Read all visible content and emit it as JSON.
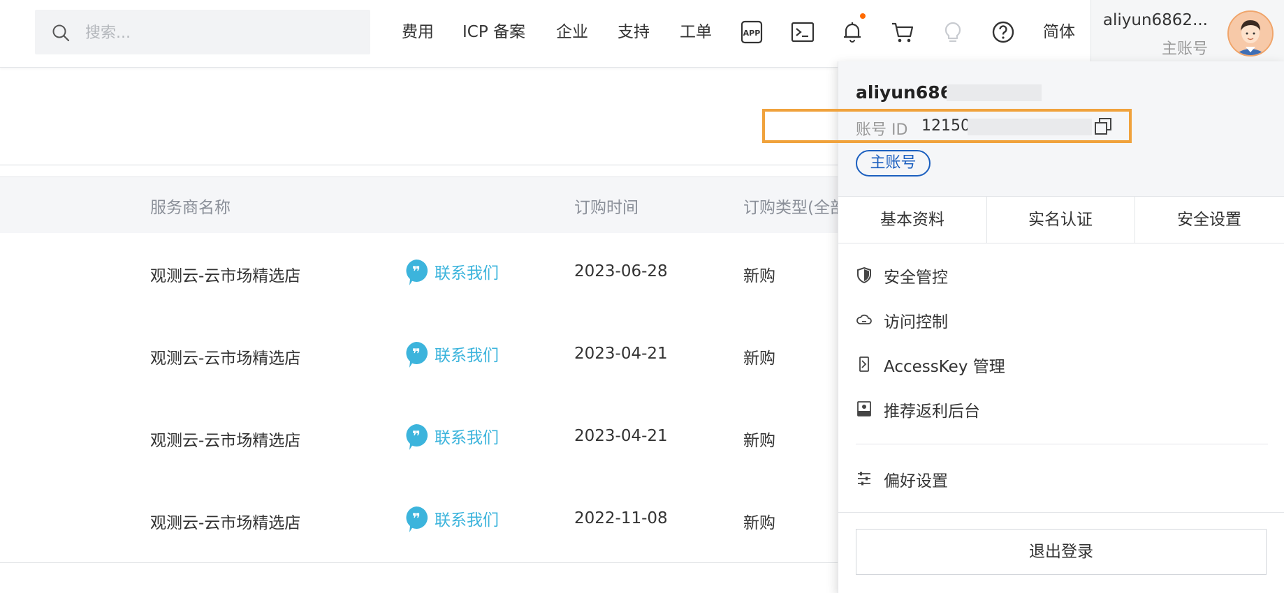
{
  "search": {
    "placeholder": "搜索..."
  },
  "nav": {
    "items": [
      "费用",
      "ICP 备案",
      "企业",
      "支持",
      "工单"
    ],
    "icons": [
      "app-icon",
      "terminal-icon",
      "bell-icon",
      "cart-icon",
      "lightbulb-icon",
      "help-icon"
    ],
    "language": "简体",
    "notification_color": "#ff6a00"
  },
  "account": {
    "name": "aliyun6862...",
    "role": "主账号"
  },
  "table": {
    "headers": [
      "服务商名称",
      "订购时间",
      "订购类型(全部"
    ],
    "rows": [
      {
        "provider": "观测云-云市场精选店",
        "contact": "联系我们",
        "date": "2023-06-28",
        "type": "新购"
      },
      {
        "provider": "观测云-云市场精选店",
        "contact": "联系我们",
        "date": "2023-04-21",
        "type": "新购"
      },
      {
        "provider": "观测云-云市场精选店",
        "contact": "联系我们",
        "date": "2023-04-21",
        "type": "新购"
      },
      {
        "provider": "观测云-云市场精选店",
        "contact": "联系我们",
        "date": "2022-11-08",
        "type": "新购"
      }
    ],
    "contact_color": "#3cb4dc"
  },
  "dropdown": {
    "username": "aliyun686",
    "id_label": "账号 ID",
    "id_value": "12150",
    "role_tag": "主账号",
    "tabs": [
      "基本资料",
      "实名认证",
      "安全设置"
    ],
    "menu": [
      {
        "icon": "shield-icon",
        "label": "安全管控"
      },
      {
        "icon": "cloud-icon",
        "label": "访问控制"
      },
      {
        "icon": "key-icon",
        "label": "AccessKey 管理"
      },
      {
        "icon": "rebate-icon",
        "label": "推荐返利后台"
      }
    ],
    "preferences": {
      "icon": "sliders-icon",
      "label": "偏好设置"
    },
    "logout": "退出登录",
    "highlight_color": "#f0a23c",
    "tag_color": "#1b5fbf"
  }
}
